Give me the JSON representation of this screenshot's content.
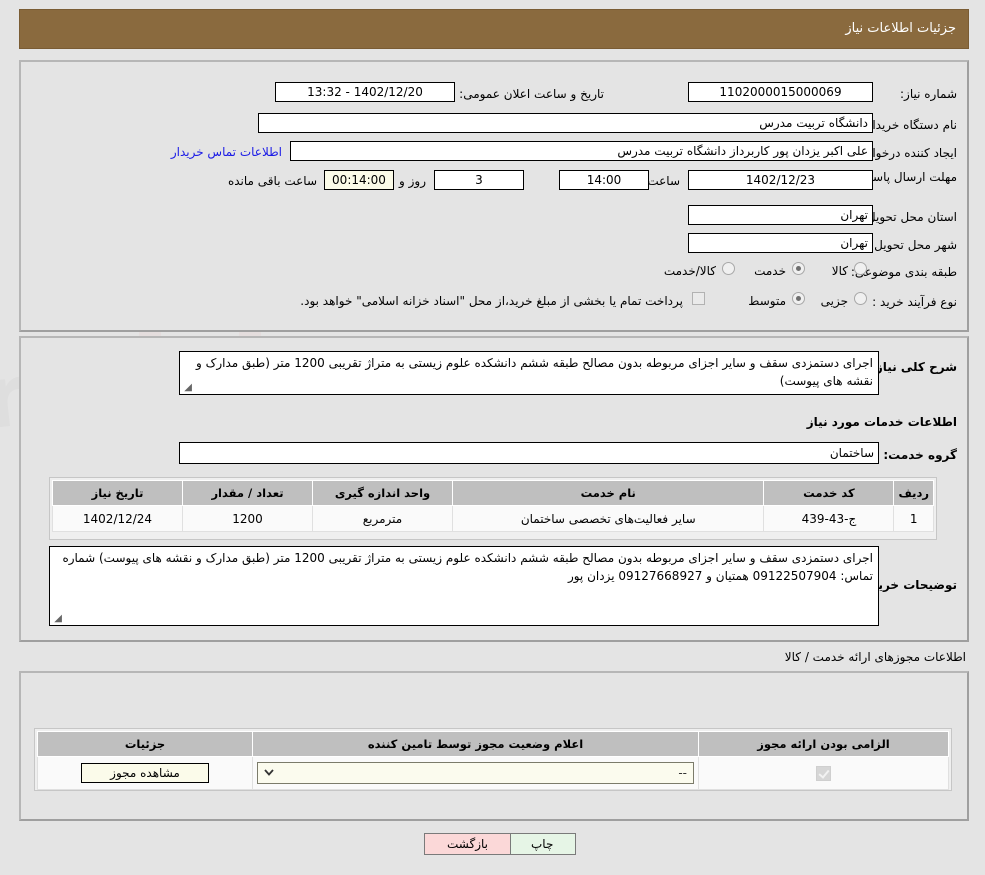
{
  "header": {
    "title": "جزئیات اطلاعات نیاز"
  },
  "form": {
    "need_number_label": "شماره نیاز:",
    "need_number_value": "1102000015000069",
    "announce_label": "تاریخ و ساعت اعلان عمومی:",
    "announce_value": "1402/12/20 - 13:32",
    "buyer_org_label": "نام دستگاه خریدار:",
    "buyer_org_value": "دانشگاه تربیت مدرس",
    "creator_label": "ایجاد کننده درخواست:",
    "creator_value": "علی اکبر یزدان پور کاربرداز دانشگاه تربیت مدرس",
    "contact_link": "اطلاعات تماس خریدار",
    "deadline_label": "مهلت ارسال پاسخ: تا تاریخ:",
    "deadline_date": "1402/12/23",
    "hour_label": "ساعت",
    "deadline_time": "14:00",
    "days_value": "3",
    "days_label": "روز و",
    "remaining_time": "00:14:00",
    "remaining_label": "ساعت باقی مانده",
    "province_label": "استان محل تحویل:",
    "province_value": "تهران",
    "city_label": "شهر محل تحویل:",
    "city_value": "تهران",
    "category_label": "طبقه بندی موضوعی:",
    "category_options": [
      "کالا",
      "خدمت",
      "کالا/خدمت"
    ],
    "category_selected": 1,
    "process_label": "نوع فرآیند خرید :",
    "process_options": [
      "جزیی",
      "متوسط"
    ],
    "process_selected": 1,
    "treasury_note": "پرداخت تمام یا بخشی از مبلغ خرید،از محل \"اسناد خزانه اسلامی\" خواهد بود."
  },
  "description": {
    "label": "شرح کلی نیاز:",
    "value": "اجرای دستمزدی سقف و سایر اجزای مربوطه بدون مصالح طبقه ششم دانشکده علوم زیستی به متراژ تقریبی 1200 متر (طبق مدارک و نقشه های پیوست)"
  },
  "services": {
    "section_title": "اطلاعات خدمات مورد نیاز",
    "group_label": "گروه خدمت:",
    "group_value": "ساختمان",
    "columns": [
      "ردیف",
      "کد خدمت",
      "نام خدمت",
      "واحد اندازه گیری",
      "تعداد / مقدار",
      "تاریخ نیاز"
    ],
    "rows": [
      {
        "row": "1",
        "code": "ج-43-439",
        "name": "سایر فعالیت‌های تخصصی ساختمان",
        "unit": "مترمربع",
        "qty": "1200",
        "date": "1402/12/24"
      }
    ]
  },
  "buyer_notes": {
    "label": "توضیحات خریدار:",
    "value": "اجرای دستمزدی سقف و سایر اجزای مربوطه بدون مصالح طبقه ششم دانشکده علوم زیستی به متراژ تقریبی 1200 متر (طبق مدارک و نقشه های پیوست) شماره تماس: 09122507904 همتیان و 09127668927 یزدان پور"
  },
  "permits": {
    "section_title": "اطلاعات مجوزهای ارائه خدمت / کالا",
    "columns": [
      "الزامی بودن ارائه مجوز",
      "اعلام وضعیت مجوز توسط تامین کننده",
      "جزئیات"
    ],
    "rows": [
      {
        "required": true,
        "status_value": "--",
        "detail_button": "مشاهده مجوز"
      }
    ]
  },
  "footer": {
    "print_label": "چاپ",
    "back_label": "بازگشت"
  },
  "watermark": {
    "text": "AriaTender.net"
  },
  "colors": {
    "header_bar": "#8a6a3e",
    "page_bg": "#e4e4e4",
    "link": "#1a1ae6",
    "table_header": "#bfbfbf",
    "print_btn": "#e6f5e6",
    "back_btn": "#fbd8d8",
    "cream_field": "#fbfbe8"
  }
}
